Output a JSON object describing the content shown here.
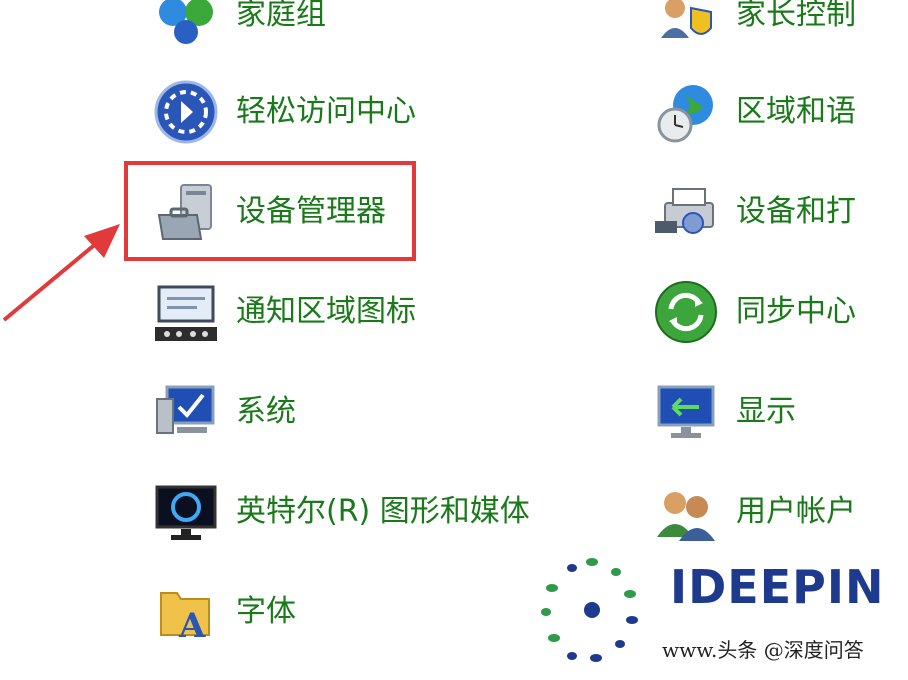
{
  "control_panel": {
    "left_items": [
      {
        "label": "家庭组",
        "icon": "homegroup-icon"
      },
      {
        "label": "轻松访问中心",
        "icon": "ease-of-access-icon"
      },
      {
        "label": "设备管理器",
        "icon": "device-manager-icon"
      },
      {
        "label": "通知区域图标",
        "icon": "notification-area-icon"
      },
      {
        "label": "系统",
        "icon": "system-icon"
      },
      {
        "label": "英特尔(R) 图形和媒体",
        "icon": "intel-graphics-icon"
      },
      {
        "label": "字体",
        "icon": "fonts-icon"
      }
    ],
    "right_items": [
      {
        "label": "家长控制",
        "icon": "parental-controls-icon"
      },
      {
        "label": "区域和语",
        "icon": "region-language-icon"
      },
      {
        "label": "设备和打",
        "icon": "devices-printers-icon"
      },
      {
        "label": "同步中心",
        "icon": "sync-center-icon"
      },
      {
        "label": "显示",
        "icon": "display-icon"
      },
      {
        "label": "用户帐户",
        "icon": "user-accounts-icon"
      }
    ]
  },
  "annotation": {
    "highlight_color": "#e23a3a",
    "highlighted_item": "设备管理器"
  },
  "watermark": {
    "logo_text": "IDEEPIN",
    "subtitle": "www.头条 @深度问答"
  },
  "colors": {
    "label_green": "#1a7a1a",
    "background": "#ffffff"
  }
}
